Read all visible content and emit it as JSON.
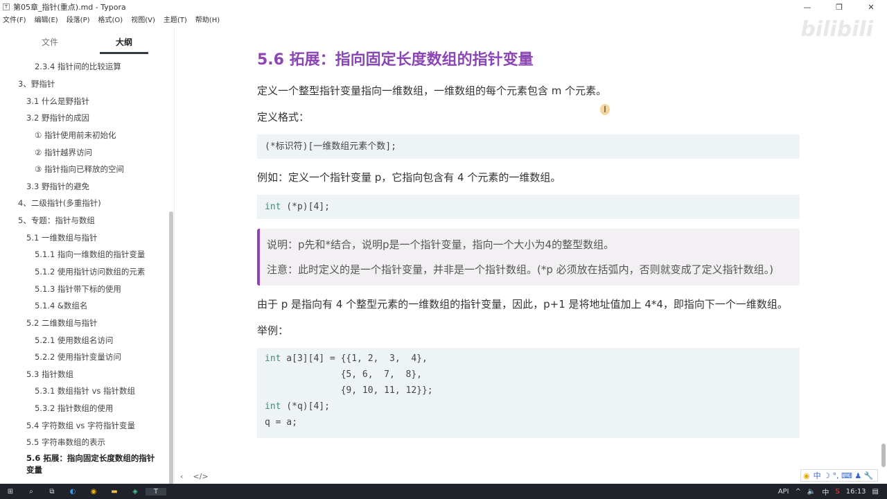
{
  "window": {
    "title": "第05章_指针(重点).md - Typora",
    "app_icon": "T",
    "minimize": "—",
    "maximize": "❐",
    "close": "✕"
  },
  "menu": [
    "文件(F)",
    "编辑(E)",
    "段落(P)",
    "格式(O)",
    "视图(V)",
    "主题(T)",
    "帮助(H)"
  ],
  "sidebar": {
    "tabs": [
      "文件",
      "大纲"
    ],
    "outline": [
      {
        "label": "2.3.4 指针间的比较运算",
        "level": 3
      },
      {
        "label": "3、野指针",
        "level": 1
      },
      {
        "label": "3.1 什么是野指针",
        "level": 2
      },
      {
        "label": "3.2 野指针的成因",
        "level": 2
      },
      {
        "label": "① 指针使用前未初始化",
        "level": 3
      },
      {
        "label": "② 指针越界访问",
        "level": 3
      },
      {
        "label": "③ 指针指向已释放的空间",
        "level": 3
      },
      {
        "label": "3.3 野指针的避免",
        "level": 2
      },
      {
        "label": "4、二级指针(多重指针)",
        "level": 1
      },
      {
        "label": "5、专题：指针与数组",
        "level": 1
      },
      {
        "label": "5.1 一维数组与指针",
        "level": 2
      },
      {
        "label": "5.1.1 指向一维数组的指针变量",
        "level": 3
      },
      {
        "label": "5.1.2 使用指针访问数组的元素",
        "level": 3
      },
      {
        "label": "5.1.3 指针带下标的使用",
        "level": 3
      },
      {
        "label": "5.1.4 &数组名",
        "level": 3
      },
      {
        "label": "5.2 二维数组与指针",
        "level": 2
      },
      {
        "label": "5.2.1 使用数组名访问",
        "level": 3
      },
      {
        "label": "5.2.2 使用指针变量访问",
        "level": 3
      },
      {
        "label": "5.3 指针数组",
        "level": 2
      },
      {
        "label": "5.3.1 数组指针 vs 指针数组",
        "level": 3
      },
      {
        "label": "5.3.2 指针数组的使用",
        "level": 3
      },
      {
        "label": "5.4 字符数组 vs 字符指针变量",
        "level": 2
      },
      {
        "label": "5.5 字符串数组的表示",
        "level": 2
      },
      {
        "label": "5.6 拓展：指向固定长度数组的指针变量",
        "level": 2,
        "active": true
      }
    ],
    "footer": {
      "collapse": "‹",
      "source": "</>"
    }
  },
  "content": {
    "heading": "5.6 拓展：指向固定长度数组的指针变量",
    "p1": "定义一个整型指针变量指向一维数组，一维数组的每个元素包含 m 个元素。",
    "p2": "定义格式：",
    "code1": "(*标识符)[一维数组元素个数];",
    "p3": "例如：定义一个指针变量 p，它指向包含有 4 个元素的一维数组。",
    "code2_kw": "int",
    "code2_rest": " (*p)[4];",
    "quote1": "说明：p先和*结合，说明p是一个指针变量，指向一个大小为4的整型数组。",
    "quote2": "注意：此时定义的是一个指针变量，并非是一个指针数组。(*p 必须放在括弧内，否则就变成了定义指针数组。)",
    "p4": "由于 p 是指向有 4 个整型元素的一维数组的指针变量，因此，p+1 是将地址值加上 4*4，即指向下一个一维数组。",
    "p5": "举例：",
    "code3": [
      {
        "kw": "int",
        "rest": " a[3][4] = {{1, 2,  3,  4},"
      },
      {
        "kw": "",
        "rest": "              {5, 6,  7,  8},"
      },
      {
        "kw": "",
        "rest": "              {9, 10, 11, 12}};"
      },
      {
        "kw": "int",
        "rest": " (*q)[4];"
      },
      {
        "kw": "",
        "rest": "q = a;"
      }
    ]
  },
  "watermark": "bilibili",
  "ime": "中 ☽ °, ⌨ ♟ 🔧",
  "taskbar": {
    "tray_text": "API",
    "lang": "中",
    "time": "16:13"
  }
}
